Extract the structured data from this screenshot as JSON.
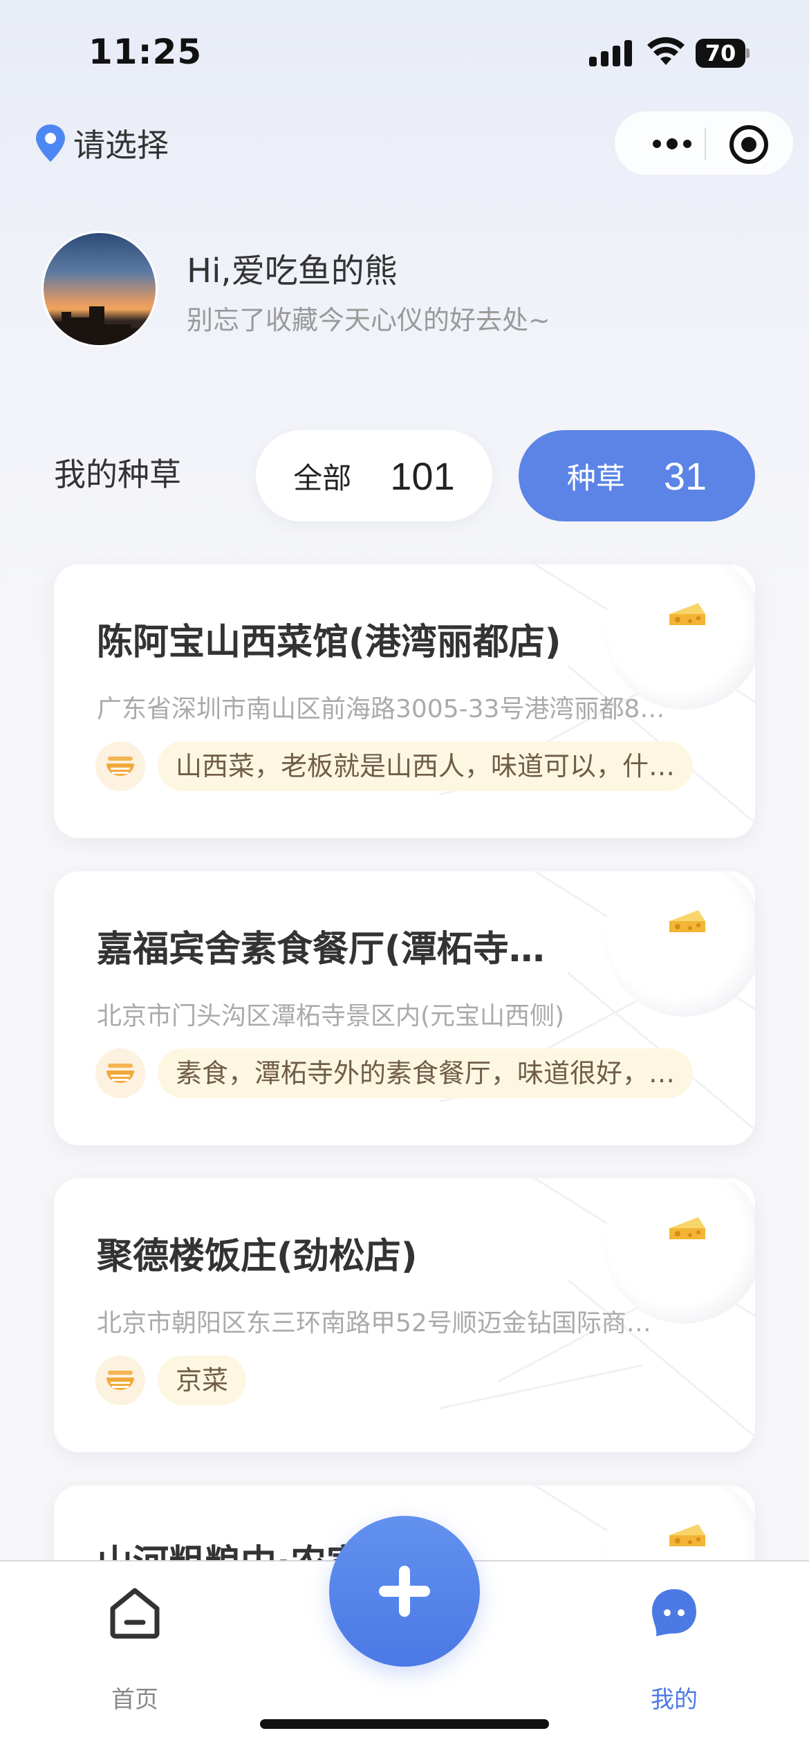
{
  "status_bar": {
    "time": "11:25",
    "battery": "70"
  },
  "header": {
    "location_label": "请选择",
    "location_icon": "location-pin-icon",
    "more_icon": "more-dots-icon",
    "close_icon": "target-circle-icon"
  },
  "profile": {
    "greeting": "Hi,爱吃鱼的熊",
    "subtitle": "别忘了收藏今天心仪的好去处~"
  },
  "filter": {
    "title": "我的种草",
    "options": [
      {
        "label": "全部",
        "count": "101",
        "selected": false
      },
      {
        "label": "种草",
        "count": "31",
        "selected": true
      }
    ]
  },
  "restaurants": [
    {
      "name": "陈阿宝山西菜馆(港湾丽都店)",
      "address": "广东省深圳市南山区前海路3005-33号港湾丽都8…",
      "tag": "山西菜，老板就是山西人，味道可以，什…",
      "icon": "cheese-icon"
    },
    {
      "name": "嘉福宾舍素食餐厅(潭柘寺…",
      "address": "北京市门头沟区潭柘寺景区内(元宝山西侧)",
      "tag": "素食，潭柘寺外的素食餐厅，味道很好，…",
      "icon": "cheese-icon"
    },
    {
      "name": "聚德楼饭庄(劲松店)",
      "address": "北京市朝阳区东三环南路甲52号顺迈金钻国际商…",
      "tag": "京菜",
      "icon": "cheese-icon"
    },
    {
      "name": "山河粗粮中·农家大望…",
      "icon": "cheese-icon"
    }
  ],
  "tabbar": {
    "home_label": "首页",
    "mine_label": "我的",
    "active": "mine"
  },
  "colors": {
    "accent": "#5b84e6",
    "tag_bg": "#fdf7e2",
    "tag_text": "#705d48"
  }
}
